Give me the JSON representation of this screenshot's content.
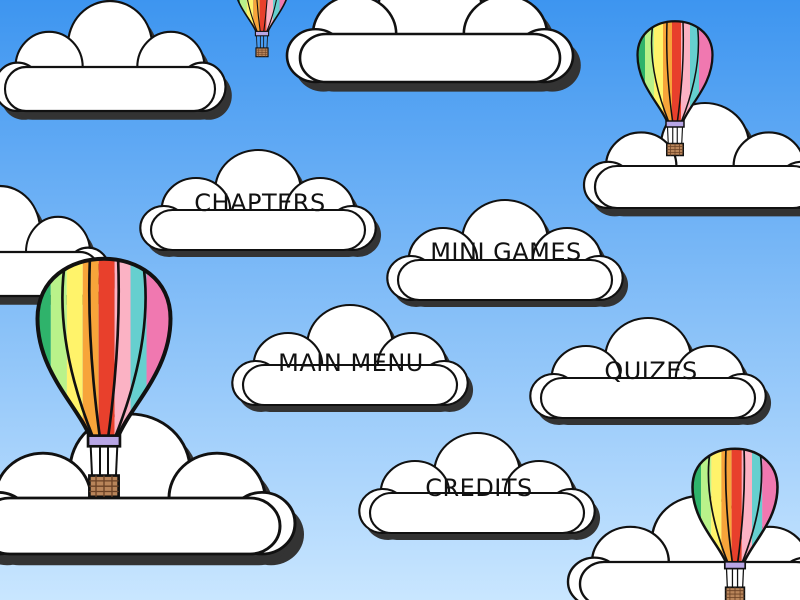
{
  "menu": {
    "chapters": "CHAPTERS",
    "mini_games": "MINI GAMES",
    "main_menu": "MAIN MENU",
    "quizes": "QUIZES",
    "credits": "CREDITS"
  },
  "colors": {
    "sky_top": "#3d95f0",
    "sky_bottom": "#c9e6ff",
    "cloud": "#ffffff",
    "cloud_outline": "#1a1a1a",
    "balloon_stripes": [
      "#2fb36b",
      "#b9f28a",
      "#fff36a",
      "#f7a43a",
      "#e8402c",
      "#fbb2c4",
      "#66cfcf",
      "#f078b0"
    ],
    "basket": "#b9855a"
  },
  "icons": {
    "balloon": "hot-air-balloon-icon",
    "cloud": "cloud-button"
  }
}
